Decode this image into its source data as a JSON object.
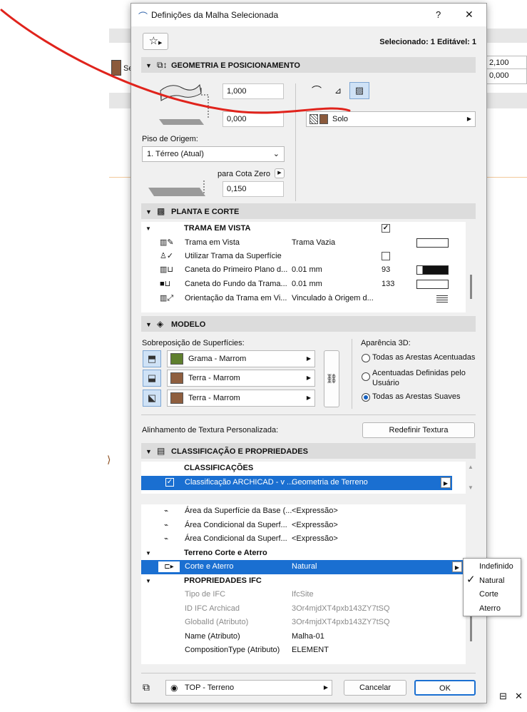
{
  "background": {
    "left_swatch_label": "Se",
    "right_values": [
      "2,100",
      "0,000"
    ],
    "bottom_right_icons": [
      "⊟",
      "✕"
    ]
  },
  "dialog": {
    "title": "Definições da Malha Selecionada",
    "help_label": "?",
    "close_label": "✕",
    "selected_info": "Selecionado: 1 Editável: 1",
    "favorites_icon": "☆"
  },
  "geometry": {
    "header": "GEOMETRIA E POSICIONAMENTO",
    "height_value": "1,000",
    "offset_value": "0,000",
    "origin_story_label": "Piso de Origem:",
    "origin_story_value": "1. Térreo (Atual)",
    "to_zero_label": "para Cota Zero",
    "zero_value": "0,150",
    "material_label": "Solo",
    "material_color": "#8b5a3c"
  },
  "plan": {
    "header": "PLANTA E CORTE",
    "group_title": "TRAMA EM VISTA",
    "rows": [
      {
        "icon": "▥✎",
        "label": "Trama em Vista",
        "value": "Trama Vazia",
        "extra": ""
      },
      {
        "icon": "♙✓",
        "label": "Utilizar Trama da Superfície",
        "value": "",
        "extra": ""
      },
      {
        "icon": "▥⊔",
        "label": "Caneta do Primeiro Plano d...",
        "value": "0.01 mm",
        "extra": "93"
      },
      {
        "icon": "■⊔",
        "label": "Caneta do Fundo da Trama...",
        "value": "0.01 mm",
        "extra": "133"
      },
      {
        "icon": "▥⤢",
        "label": "Orientação da Trama em Vi...",
        "value": "Vinculado à Origem d...",
        "extra": ""
      }
    ]
  },
  "model": {
    "header": "MODELO",
    "overlap_label": "Sobreposição de Superfícies:",
    "surfaces": [
      {
        "label": "Grama - Marrom",
        "color": "#5f7f2e"
      },
      {
        "label": "Terra - Marrom",
        "color": "#8e5e3e"
      },
      {
        "label": "Terra - Marrom",
        "color": "#8e5e3e"
      }
    ],
    "appearance_label": "Aparência 3D:",
    "appearance_options": [
      "Todas as Arestas Acentuadas",
      "Acentuadas Definidas pelo",
      "Usuário",
      "Todas as Arestas Suaves"
    ],
    "texture_label": "Alinhamento de Textura Personalizada:",
    "texture_button": "Redefinir Textura"
  },
  "classification": {
    "header": "CLASSIFICAÇÃO E PROPRIEDADES",
    "group_title": "CLASSIFICAÇÕES",
    "selected_row_label": "Classificação ARCHICAD - v ...",
    "selected_row_value": "Geometria de Terreno",
    "property_rows": [
      {
        "label": "Área da Superfície da Base (...",
        "value": "<Expressão>"
      },
      {
        "label": "Área Condicional da Superf...",
        "value": "<Expressão>"
      },
      {
        "label": "Área Condicional da Superf...",
        "value": "<Expressão>"
      }
    ],
    "terrain_group": "Terreno Corte e Aterro",
    "cut_fill_label": "Corte e Aterro",
    "cut_fill_value": "Natural",
    "ifc_group": "PROPRIEDADES IFC",
    "ifc_rows": [
      {
        "label": "Tipo de IFC",
        "value": "IfcSite",
        "dim": true
      },
      {
        "label": "ID IFC Archicad",
        "value": "3Or4mjdXT4pxb143ZY7tSQ",
        "dim": true
      },
      {
        "label": "GlobalId (Atributo)",
        "value": "3Or4mjdXT4pxb143ZY7tSQ",
        "dim": true
      },
      {
        "label": "Name (Atributo)",
        "value": "Malha-01",
        "dim": false
      },
      {
        "label": "CompositionType (Atributo)",
        "value": "ELEMENT",
        "dim": false
      }
    ]
  },
  "popup": {
    "options": [
      "Indefinido",
      "Natural",
      "Corte",
      "Aterro"
    ],
    "checked": "Natural"
  },
  "footer": {
    "layer_label": "TOP - Terreno",
    "cancel_label": "Cancelar",
    "ok_label": "OK"
  },
  "colors": {
    "selection_blue": "#1a6fd1",
    "annotation_red": "#e0231c"
  }
}
